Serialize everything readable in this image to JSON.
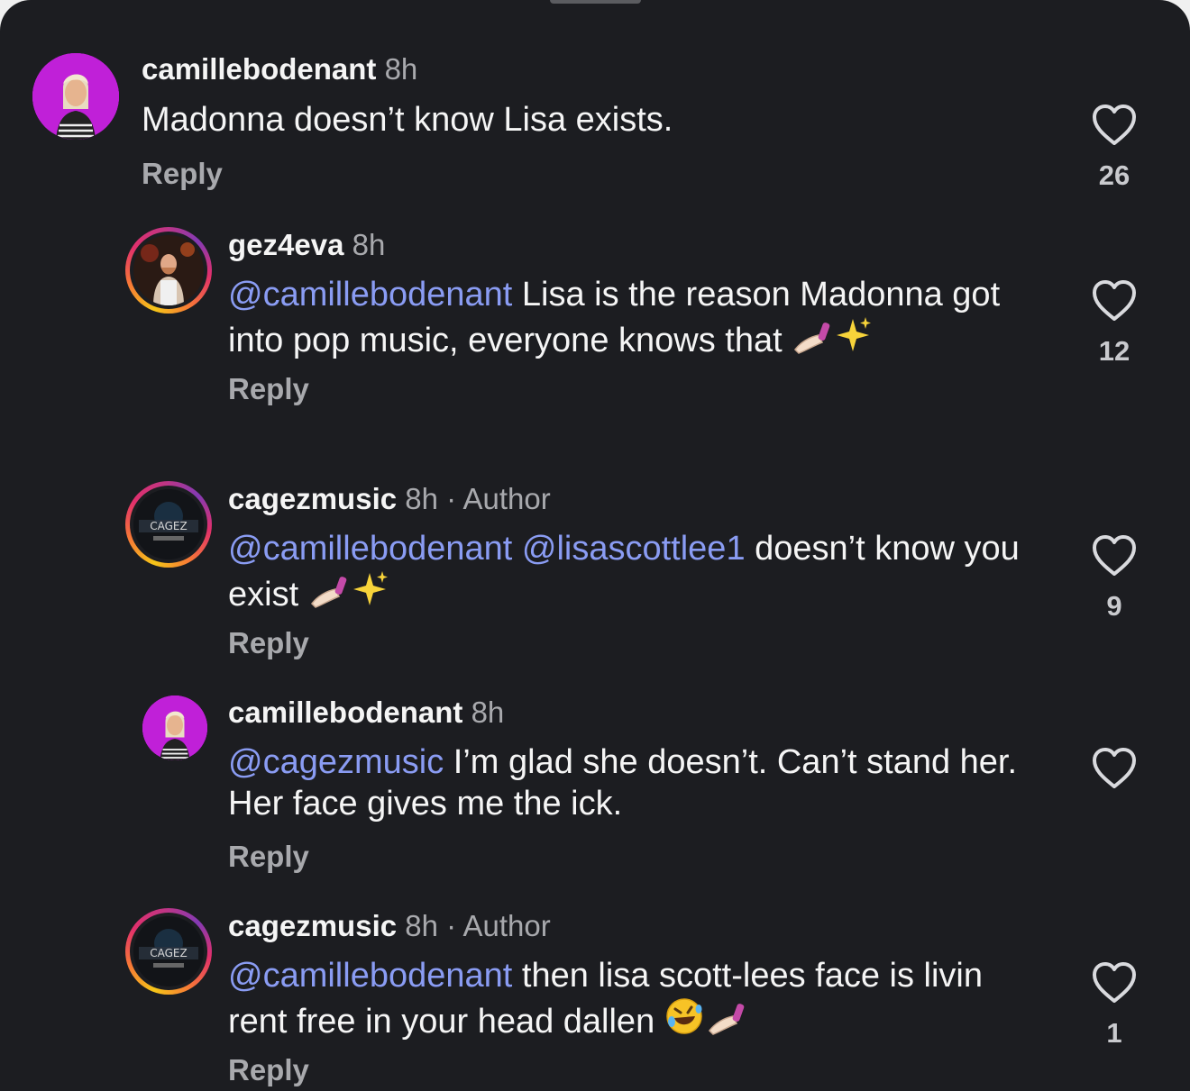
{
  "colors": {
    "background": "#1c1d21",
    "mention": "#8a9cf3",
    "muted": "#a8a9ad"
  },
  "comments": [
    {
      "username": "camillebodenant",
      "time": "8h",
      "author_badge": "",
      "mention1": "",
      "mention2": "",
      "text": "Madonna doesn’t know Lisa exists.",
      "emoji": [],
      "reply_label": "Reply",
      "likes": "26",
      "avatar_icon": "avatar-camillebodenant"
    },
    {
      "username": "gez4eva",
      "time": "8h",
      "author_badge": "",
      "mention1": "@camillebodenant",
      "mention2": "",
      "text": " Lisa is the reason Madonna got into pop music, everyone knows that ",
      "emoji": [
        "nail-polish-emoji",
        "sparkles-emoji"
      ],
      "reply_label": "Reply",
      "likes": "12",
      "avatar_icon": "avatar-gez4eva"
    },
    {
      "username": "cagezmusic",
      "time": "8h",
      "author_badge": "· Author",
      "mention1": "@camillebodenant",
      "mention2": "@lisascottlee1",
      "text": " doesn’t know you exist ",
      "emoji": [
        "nail-polish-emoji",
        "sparkles-emoji"
      ],
      "reply_label": "Reply",
      "likes": "9",
      "avatar_icon": "avatar-cagezmusic",
      "avatar_logo_text": "CAGEZ"
    },
    {
      "username": "camillebodenant",
      "time": "8h",
      "author_badge": "",
      "mention1": "@cagezmusic",
      "mention2": "",
      "text": " I’m glad she doesn’t. Can’t stand her. Her face gives me the ick.",
      "emoji": [],
      "reply_label": "Reply",
      "likes": "",
      "avatar_icon": "avatar-camillebodenant"
    },
    {
      "username": "cagezmusic",
      "time": "8h",
      "author_badge": "· Author",
      "mention1": "@camillebodenant",
      "mention2": "",
      "text": " then lisa scott-lees face is livin rent free in your head dallen ",
      "emoji": [
        "rolling-on-floor-laughing-emoji",
        "nail-polish-emoji"
      ],
      "reply_label": "Reply",
      "likes": "1",
      "avatar_icon": "avatar-cagezmusic",
      "avatar_logo_text": "CAGEZ"
    }
  ]
}
